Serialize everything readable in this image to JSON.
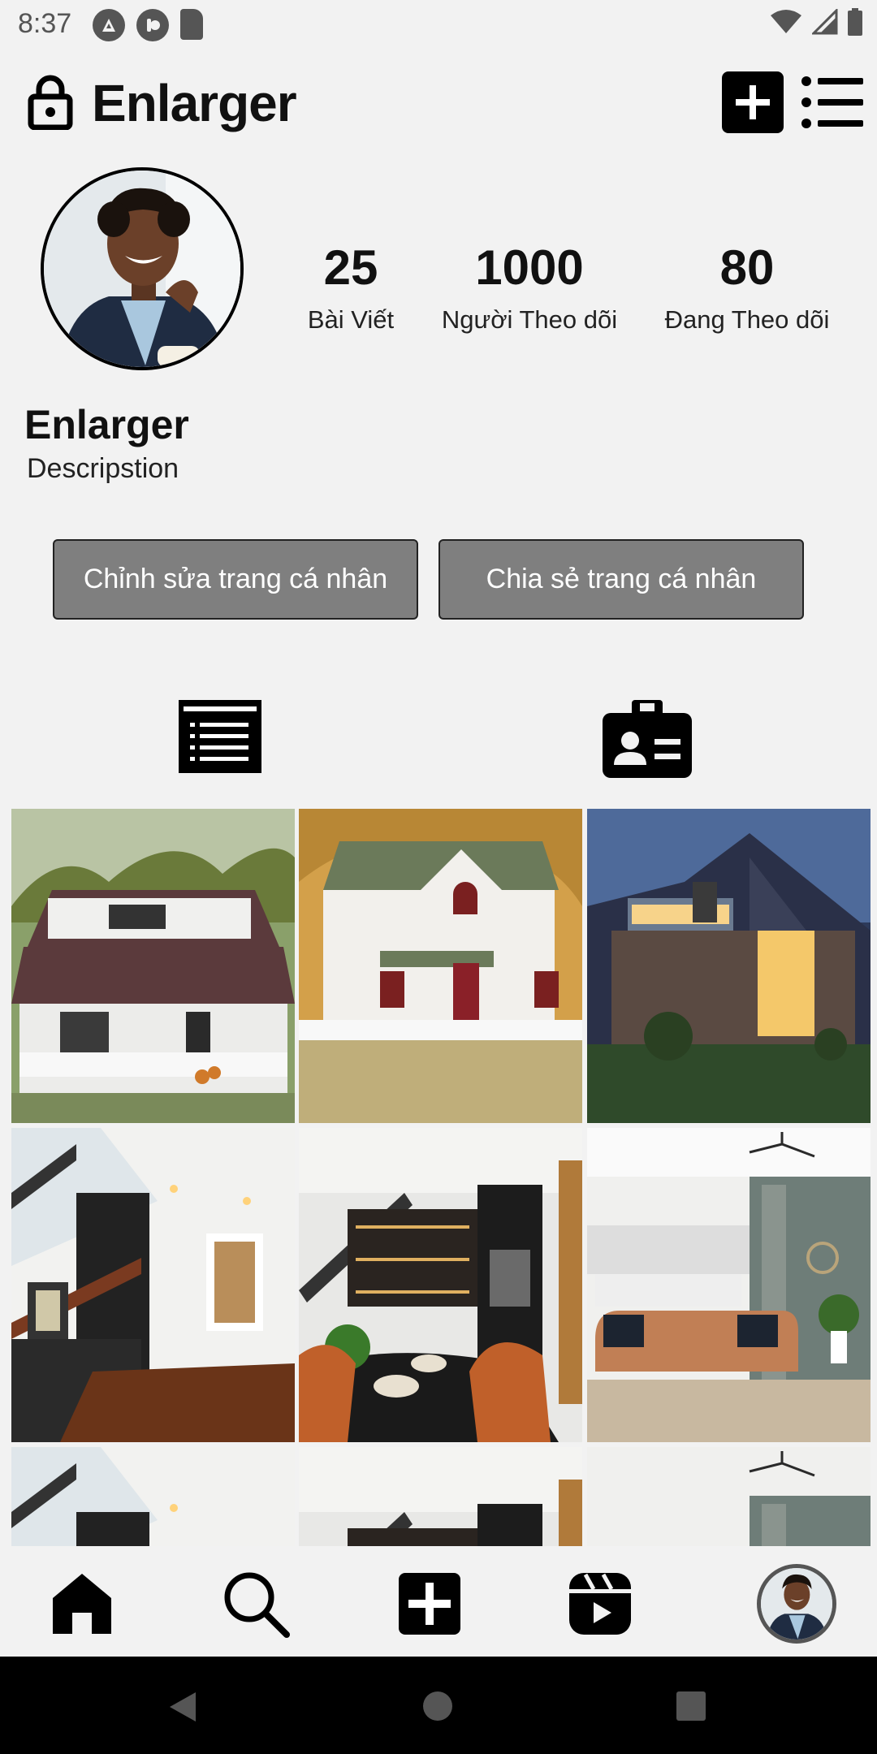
{
  "status_bar": {
    "time": "8:37",
    "left_icons": [
      "accessibility-icon",
      "play-protect-icon",
      "sd-card-icon"
    ],
    "right_icons": [
      "wifi-icon",
      "signal-icon",
      "battery-icon"
    ]
  },
  "header": {
    "title": "Enlarger",
    "lock_icon": "lock-icon",
    "add_icon": "plus-square-icon",
    "menu_icon": "list-menu-icon"
  },
  "profile": {
    "name": "Enlarger",
    "description": "Descripstion",
    "stats": [
      {
        "value": "25",
        "label": "Bài Viết"
      },
      {
        "value": "1000",
        "label": "Người Theo dõi"
      },
      {
        "value": "80",
        "label": "Đang Theo dõi"
      }
    ]
  },
  "actions": {
    "edit_label": "Chỉnh sửa trang cá nhân",
    "share_label": "Chia sẻ trang cá nhân"
  },
  "tabs": [
    {
      "icon": "posts-list-icon"
    },
    {
      "icon": "tagged-contact-icon"
    }
  ],
  "bottom_nav": [
    {
      "icon": "home-icon"
    },
    {
      "icon": "search-icon"
    },
    {
      "icon": "add-post-icon"
    },
    {
      "icon": "reels-icon"
    },
    {
      "icon": "profile-avatar"
    }
  ],
  "colors": {
    "background": "#f2f2f2",
    "button_gray": "#7f7f7f",
    "text": "#111111"
  }
}
